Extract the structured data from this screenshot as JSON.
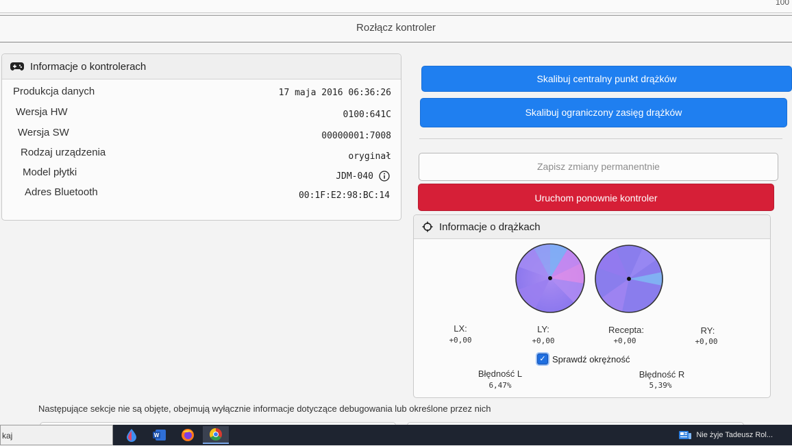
{
  "top": {
    "corner_number": "100"
  },
  "disconnect_button": "Rozłącz kontroler",
  "controller_info": {
    "title": "Informacje o kontrolerach",
    "rows": [
      {
        "label": "Produkcja danych",
        "value": "17 maja 2016 06:36:26"
      },
      {
        "label": "Wersja HW",
        "value": "0100:641C"
      },
      {
        "label": "Wersja SW",
        "value": "00000001:7008"
      },
      {
        "label": "Rodzaj urządzenia",
        "value": "oryginał"
      },
      {
        "label": "Model płytki",
        "value": "JDM-040"
      },
      {
        "label": "Adres Bluetooth",
        "value": "00:1F:E2:98:BC:14"
      }
    ]
  },
  "actions": {
    "calibrate_center": "Skalibuj centralny punkt drążków",
    "calibrate_range": "Skalibuj ograniczony zasięg drążków",
    "save_permanent": "Zapisz zmiany permanentnie",
    "restart": "Uruchom ponownie kontroler"
  },
  "stick_info": {
    "title": "Informacje o drążkach",
    "axes": [
      {
        "label": "LX:",
        "value": "+0,00"
      },
      {
        "label": "LY:",
        "value": "+0,00"
      },
      {
        "label": "Recepta:",
        "value": "+0,00"
      },
      {
        "label": "RY:",
        "value": "+0,00"
      }
    ],
    "check_circularity": "Sprawdź okrężność",
    "error_left_label": "Błędność L",
    "error_left_value": "6,47%",
    "error_right_label": "Błędność R",
    "error_right_value": "5,39%"
  },
  "footer_note": "Następujące sekcje nie są objęte, obejmują wyłącznie informacje dotyczące debugowania lub określone przez nich",
  "taskbar": {
    "search_text": "kaj",
    "apps": [
      "drop-app-icon",
      "word-icon",
      "firefox-icon",
      "chrome-icon"
    ],
    "news_text": "Nie żyje Tadeusz Rol..."
  }
}
